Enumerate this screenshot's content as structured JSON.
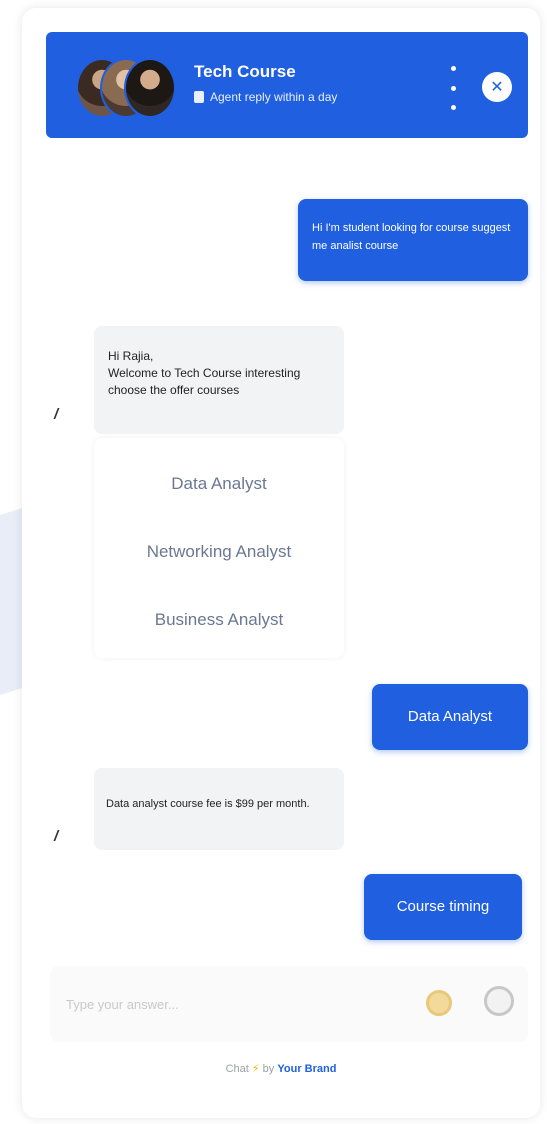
{
  "header": {
    "title": "Tech Course",
    "subtitle": "Agent reply within a day"
  },
  "messages": {
    "user_1": "Hi I'm student looking for course suggest me analist course",
    "bot_1_line1": "Hi Rajia,",
    "bot_1_line2": "Welcome to Tech Course interesting choose the offer courses",
    "options": [
      "Data Analyst",
      "Networking Analyst",
      "Business Analyst"
    ],
    "user_2": "Data Analyst",
    "bot_2": "Data analyst course fee is $99 per month.",
    "user_3": "Course timing"
  },
  "composer": {
    "placeholder": "Type your answer..."
  },
  "footer": {
    "chat_text": "Chat",
    "bolt": "⚡",
    "by_text": "by",
    "brand": "Your Brand"
  },
  "colors": {
    "primary": "#1f5fe0",
    "bot_bubble": "#f2f3f5",
    "option_text": "#6b7892"
  }
}
